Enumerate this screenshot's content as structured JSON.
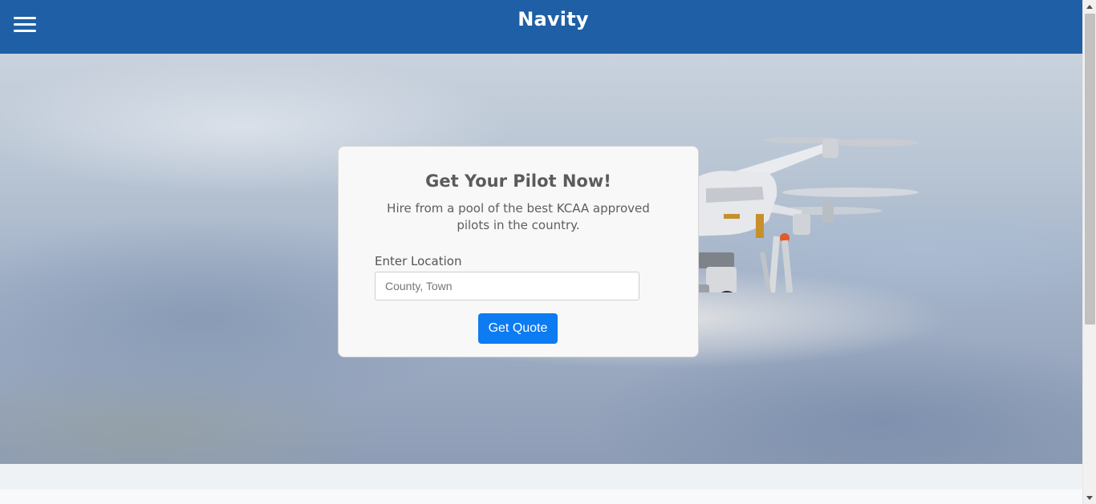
{
  "header": {
    "brand": "Navity",
    "menu_icon": "hamburger-menu-icon"
  },
  "hero": {
    "image": "drone-photo"
  },
  "quote_card": {
    "title": "Get Your Pilot Now!",
    "subtitle": "Hire from a pool of the best KCAA approved pilots in the country.",
    "location_label": "Enter Location",
    "location_placeholder": "County, Town",
    "location_value": "",
    "submit_label": "Get Quote"
  },
  "colors": {
    "header_bg": "#1f5fa6",
    "button_bg": "#0d7bf2",
    "card_bg": "#f8f8f8"
  }
}
